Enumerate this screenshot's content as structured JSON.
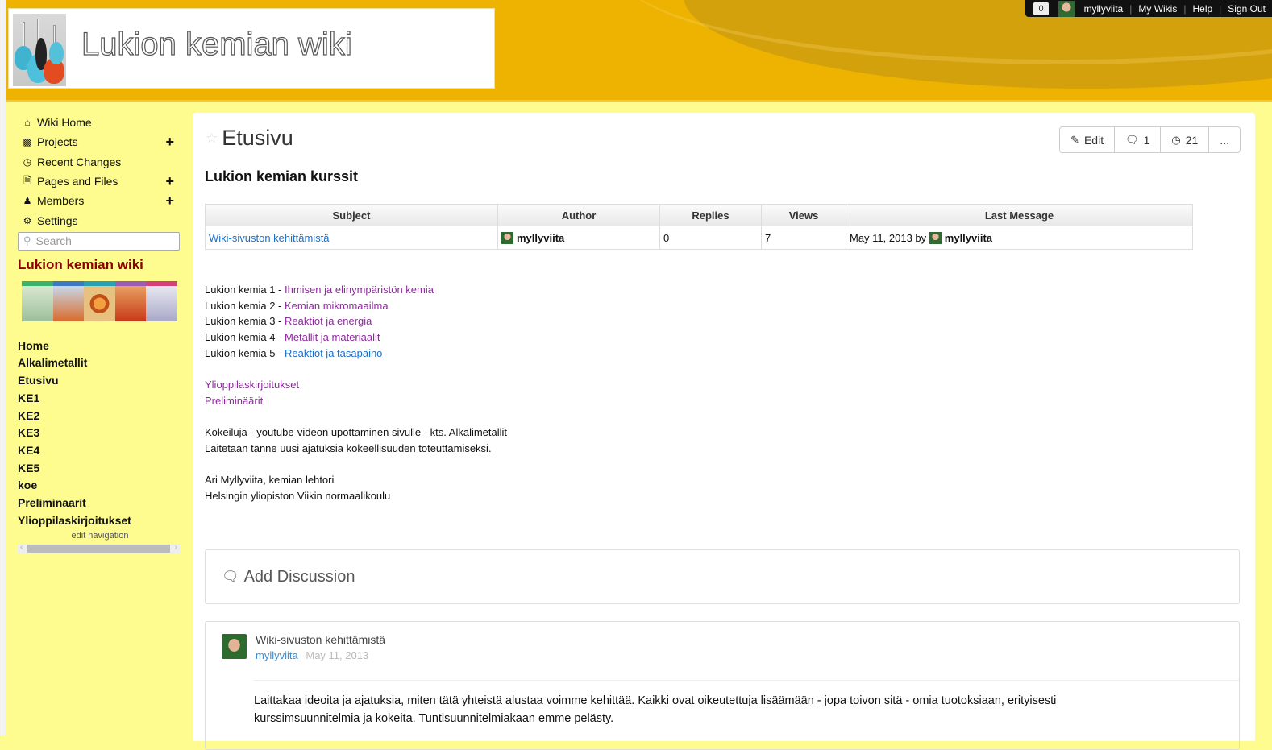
{
  "header": {
    "site_title": "Lukion kemian wiki",
    "userbar": {
      "notification_count": "0",
      "username": "myllyviita",
      "links": [
        "My Wikis",
        "Help",
        "Sign Out"
      ]
    }
  },
  "sidebar": {
    "nav": [
      {
        "label": "Wiki Home",
        "icon": "home-icon",
        "expandable": false
      },
      {
        "label": "Projects",
        "icon": "sitemap-icon",
        "expandable": true
      },
      {
        "label": "Recent Changes",
        "icon": "clock-icon",
        "expandable": false
      },
      {
        "label": "Pages and Files",
        "icon": "file-icon",
        "expandable": true
      },
      {
        "label": "Members",
        "icon": "user-icon",
        "expandable": true
      },
      {
        "label": "Settings",
        "icon": "gear-icon",
        "expandable": false
      }
    ],
    "search_placeholder": "Search",
    "wiki_name": "Lukion kemian wiki",
    "pages": [
      "Home",
      "Alkalimetallit",
      "Etusivu",
      "KE1",
      "KE2",
      "KE3",
      "KE4",
      "KE5",
      "koe",
      "Preliminaarit",
      "Ylioppilaskirjoitukset"
    ],
    "edit_navigation": "edit navigation"
  },
  "main": {
    "page_title": "Etusivu",
    "actions": {
      "edit": "Edit",
      "comments": "1",
      "revisions": "21",
      "more": "..."
    },
    "section_heading": "Lukion kemian kurssit",
    "discussion_table": {
      "columns": [
        "Subject",
        "Author",
        "Replies",
        "Views",
        "Last Message"
      ],
      "rows": [
        {
          "subject": "Wiki-sivuston kehittämistä",
          "author": "myllyviita",
          "replies": "0",
          "views": "7",
          "last_message_date": "May 11, 2013 by",
          "last_message_user": "myllyviita"
        }
      ]
    },
    "courses": [
      {
        "prefix": "Lukion kemia 1 - ",
        "link": "Ihmisen ja elinympäristön kemia",
        "visited": true
      },
      {
        "prefix": "Lukion kemia 2 - ",
        "link": "Kemian mikromaailma",
        "visited": true
      },
      {
        "prefix": "Lukion kemia 3 - ",
        "link": "Reaktiot ja energia",
        "visited": true
      },
      {
        "prefix": "Lukion kemia 4 - ",
        "link": "Metallit ja materiaalit",
        "visited": true
      },
      {
        "prefix": "Lukion kemia 5 - ",
        "link": "Reaktiot ja tasapaino",
        "visited": false
      }
    ],
    "extra_links": [
      "Ylioppilaskirjoitukset",
      "Preliminäärit"
    ],
    "paragraph1": [
      "Kokeiluja - youtube-videon upottaminen sivulle - kts. Alkalimetallit",
      "Laitetaan tänne uusi ajatuksia kokeellisuuden toteuttamiseksi."
    ],
    "signature": [
      "Ari Myllyviita, kemian lehtori",
      "Helsingin yliopiston Viikin normaalikoulu"
    ],
    "add_discussion": "Add Discussion",
    "thread": {
      "title": "Wiki-sivuston kehittämistä",
      "author": "myllyviita",
      "date": "May 11, 2013",
      "body": "Laittakaa ideoita ja ajatuksia, miten tätä yhteistä alustaa voimme kehittää. Kaikki ovat oikeutettuja lisäämään - jopa toivon sitä - omia tuotoksiaan, erityisesti kurssimsuunnitelmia ja kokeita. Tuntisuunnitelmiakaan emme pelästy."
    }
  },
  "colors": {
    "header_bg": "#edb300",
    "page_bg": "#fefc8e",
    "wiki_name": "#8b0000",
    "visited_link": "#8e2a9e",
    "link": "#1a6fc9"
  }
}
